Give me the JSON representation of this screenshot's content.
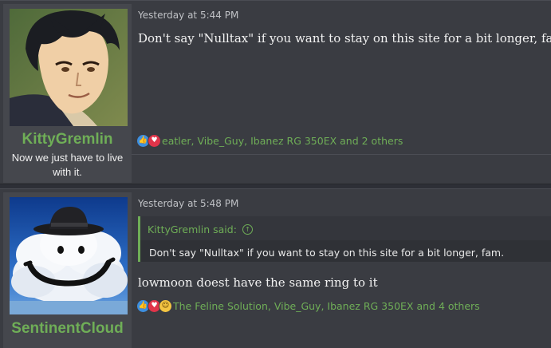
{
  "posts": [
    {
      "username": "KittyGremlin",
      "user_title": "Now we just have to live with it.",
      "date": "Yesterday at 5:44 PM",
      "message": "Don't say \"Nulltax\" if you want to stay on this site for a bit longer, fam.",
      "reactions": {
        "icons": [
          "like-icon",
          "love-icon"
        ],
        "text": "eatler, Vibe_Guy, Ibanez RG 350EX and 2 others"
      }
    },
    {
      "username": "SentinentCloud",
      "date": "Yesterday at 5:48 PM",
      "quote": {
        "author_line": "KittyGremlin said:",
        "text": "Don't say \"Nulltax\" if you want to stay on this site for a bit longer, fam."
      },
      "message": "lowmoon doest have the same ring to it",
      "reactions": {
        "icons": [
          "like-icon",
          "love-icon",
          "haha-icon"
        ],
        "text": "The Feline Solution, Vibe_Guy, Ibanez RG 350EX and 4 others"
      }
    }
  ],
  "colors": {
    "accent_green": "#6fae57",
    "post_bg": "#3a3c42",
    "page_bg": "#2d2f36"
  }
}
